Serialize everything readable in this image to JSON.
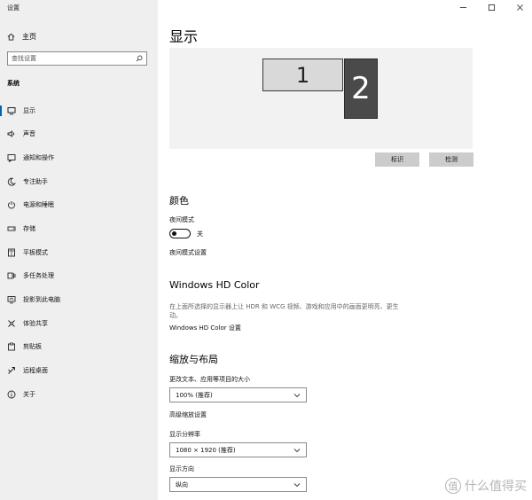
{
  "window": {
    "title": "设置"
  },
  "sidebar": {
    "home_label": "主页",
    "search_placeholder": "查找设置",
    "section_label": "系统",
    "items": [
      {
        "label": "显示",
        "icon": "monitor-icon",
        "selected": true
      },
      {
        "label": "声音",
        "icon": "speaker-icon"
      },
      {
        "label": "通知和操作",
        "icon": "notification-icon"
      },
      {
        "label": "专注助手",
        "icon": "moon-icon"
      },
      {
        "label": "电源和睡眠",
        "icon": "power-icon"
      },
      {
        "label": "存储",
        "icon": "storage-icon"
      },
      {
        "label": "平板模式",
        "icon": "tablet-icon"
      },
      {
        "label": "多任务处理",
        "icon": "multitask-icon"
      },
      {
        "label": "投影到此电脑",
        "icon": "project-icon"
      },
      {
        "label": "体验共享",
        "icon": "share-icon"
      },
      {
        "label": "剪贴板",
        "icon": "clipboard-icon"
      },
      {
        "label": "远程桌面",
        "icon": "remote-desktop-icon"
      },
      {
        "label": "关于",
        "icon": "info-icon"
      }
    ]
  },
  "main": {
    "title": "显示",
    "monitors": [
      "1",
      "2"
    ],
    "identify_label": "标识",
    "detect_label": "检测",
    "color_section": {
      "title": "颜色",
      "night_mode_label": "夜间模式",
      "night_mode_state": "关",
      "night_mode_settings_link": "夜间模式设置"
    },
    "hdr_section": {
      "title": "Windows HD Color",
      "description": "在上面所选择的显示器上让 HDR 和 WCG 视频、游戏和应用中的画面更明亮、更生动。",
      "settings_link": "Windows HD Color 设置"
    },
    "scale_section": {
      "title": "缩放与布局",
      "scale_label": "更改文本、应用等项目的大小",
      "scale_value": "100% (推荐)",
      "advanced_link": "高级缩放设置",
      "resolution_label": "显示分辨率",
      "resolution_value": "1080 × 1920 (推荐)",
      "orientation_label": "显示方向",
      "orientation_value": "纵向"
    }
  },
  "watermark": {
    "badge": "值",
    "text": "什么值得买"
  },
  "colors": {
    "accent": "#0063b1",
    "sidebar_bg": "#efefef",
    "monitor2_bg": "#4a4a4a"
  }
}
